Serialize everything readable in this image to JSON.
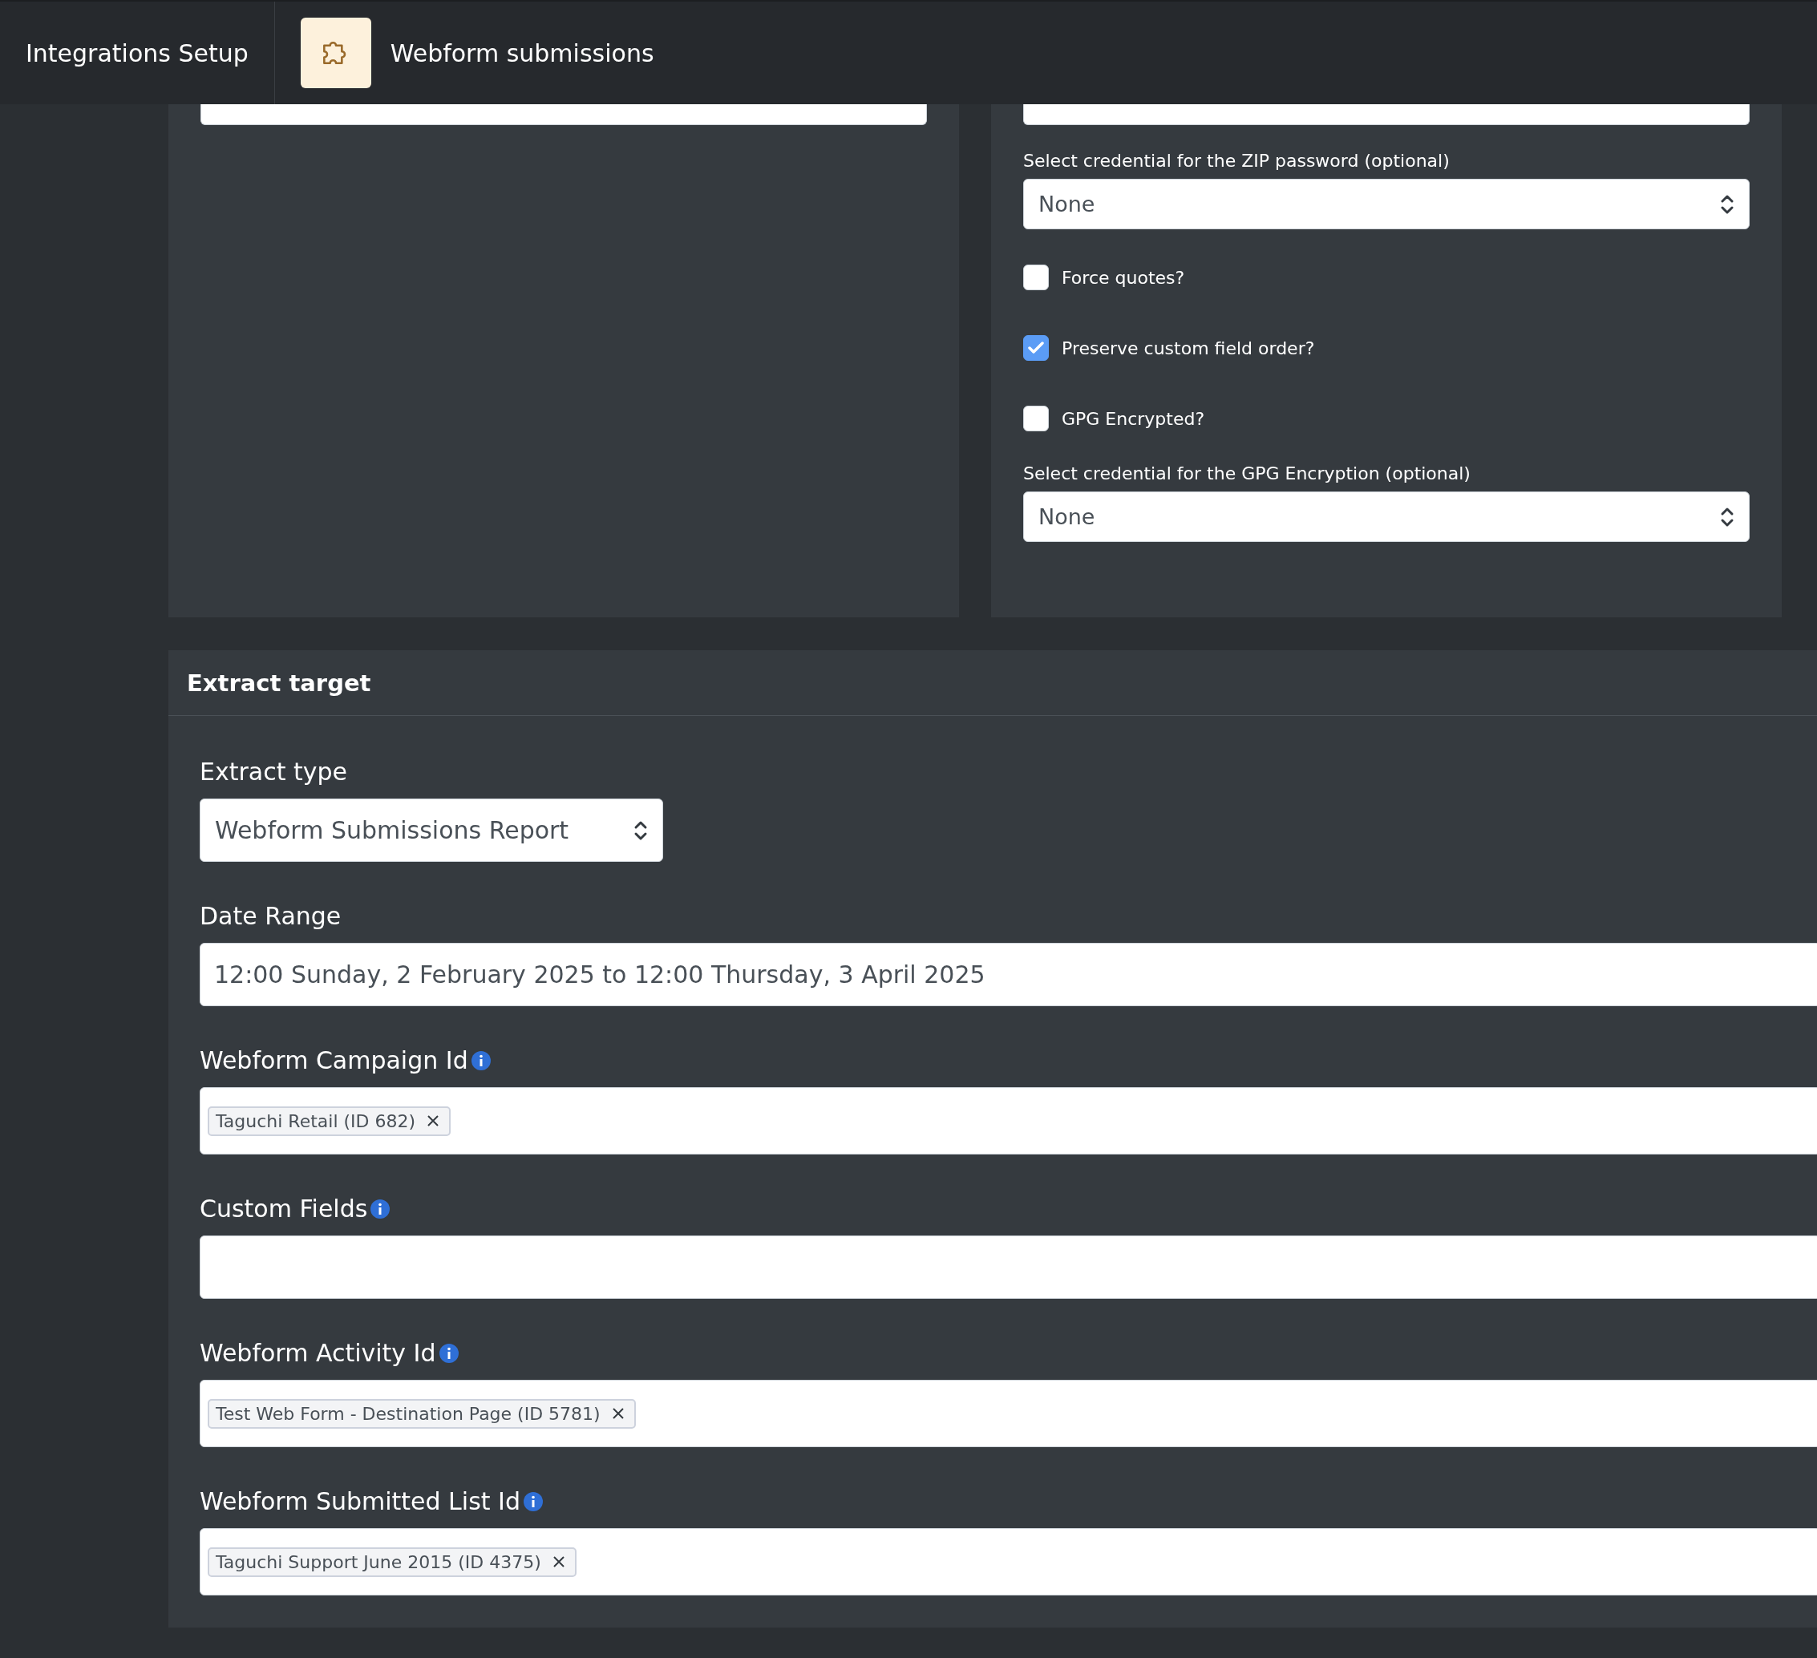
{
  "header": {
    "section": "Integrations Setup",
    "title": "Webform submissions"
  },
  "options_panel": {
    "items": [
      {
        "kind": "select",
        "label": "Select credential for the ZIP password (optional)",
        "value": "None"
      },
      {
        "kind": "checkbox",
        "label": "Force quotes?",
        "checked": false
      },
      {
        "kind": "checkbox",
        "label": "Preserve custom field order?",
        "checked": true
      },
      {
        "kind": "checkbox",
        "label": "GPG Encrypted?",
        "checked": false
      },
      {
        "kind": "select",
        "label": "Select credential for the GPG Encryption (optional)",
        "value": "None"
      }
    ]
  },
  "extract_target": {
    "title": "Extract target",
    "fields": [
      {
        "kind": "select",
        "label": "Extract type",
        "value": "Webform Submissions Report",
        "info": false
      },
      {
        "kind": "text",
        "label": "Date Range",
        "value": "12:00 Sunday, 2 February 2025 to 12:00 Thursday, 3 April 2025",
        "info": false
      },
      {
        "kind": "tags",
        "label": "Webform Campaign Id",
        "info": true,
        "tags": [
          "Taguchi Retail (ID 682)"
        ]
      },
      {
        "kind": "tags",
        "label": "Custom Fields",
        "info": true
      },
      {
        "kind": "tags",
        "label": "Webform Activity Id",
        "info": true,
        "tags": [
          "Test Web Form - Destination Page (ID 5781)"
        ]
      },
      {
        "kind": "tags",
        "label": "Webform Submitted List Id",
        "info": true,
        "tags": [
          "Taguchi Support June 2015 (ID 4375)"
        ]
      }
    ]
  }
}
